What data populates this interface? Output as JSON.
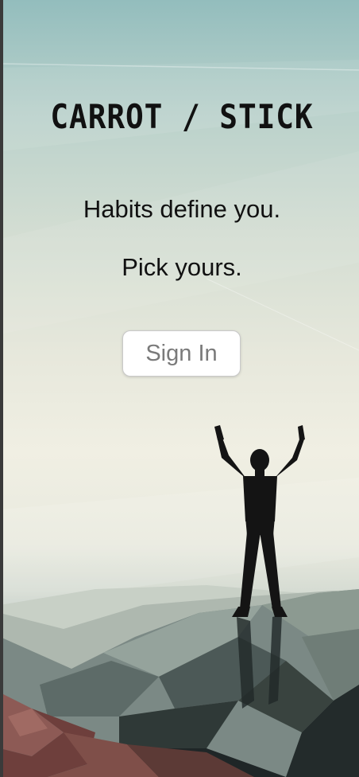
{
  "app": {
    "title": "CARROT / STICK"
  },
  "hero": {
    "line1": "Habits define you.",
    "line2": "Pick yours."
  },
  "actions": {
    "sign_in_label": "Sign In"
  },
  "background": {
    "illustration": "person-arms-raised-on-mountain-peak",
    "sky_color": "#93bdbd",
    "mist_color": "#f0efe3",
    "mountain_dark": "#1f2627",
    "rock_red": "#7a4a46"
  }
}
